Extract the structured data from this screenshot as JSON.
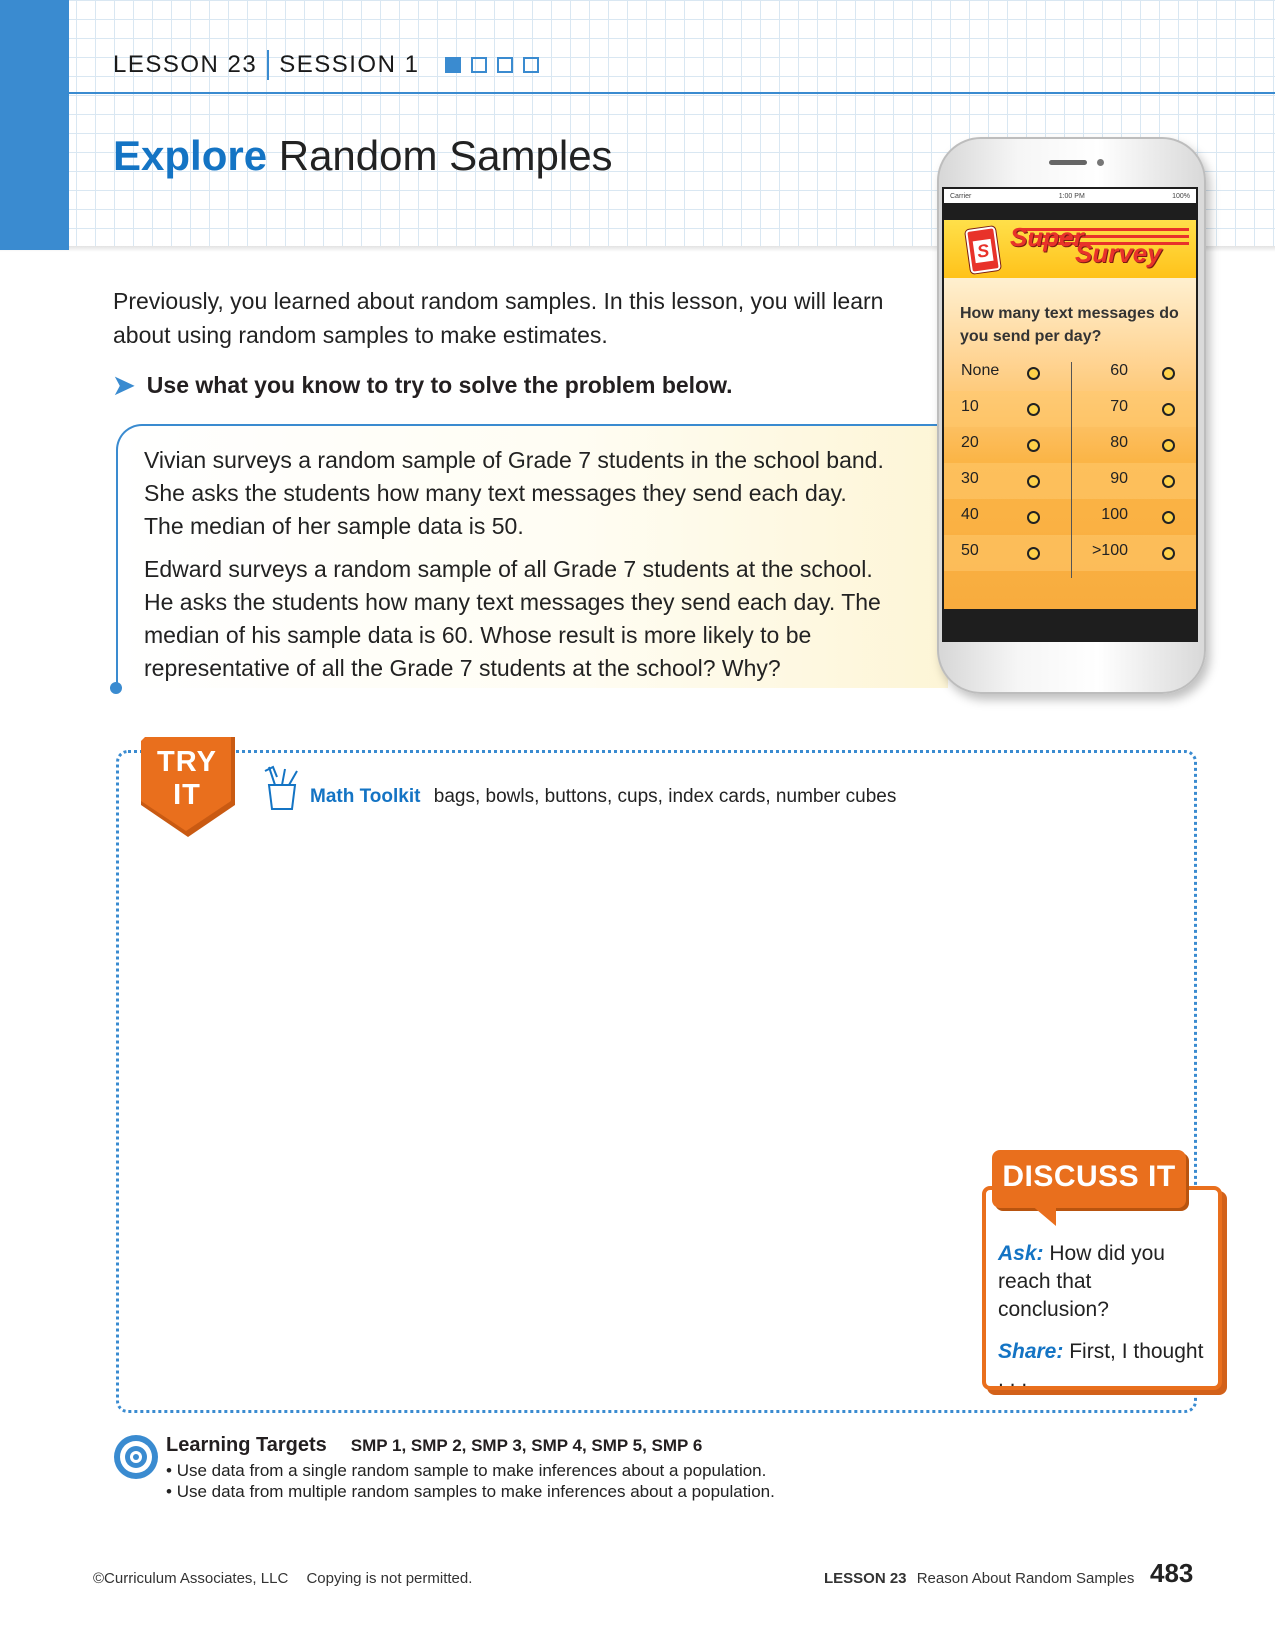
{
  "header": {
    "lesson": "LESSON 23",
    "session": "SESSION 1",
    "session_progress": {
      "current": 1,
      "total": 4
    },
    "title_emphasis": "Explore",
    "title_rest": "Random Samples"
  },
  "intro": "Previously, you learned about random samples. In this lesson, you will learn about using random samples to make estimates.",
  "instruction": "Use what you know to try to solve the problem below.",
  "problem": {
    "p1": "Vivian surveys a random sample of Grade 7 students in the school band. She asks the students how many text messages they send each day. The median of her sample data is 50.",
    "p2": "Edward surveys a random sample of all Grade 7 students at the school. He asks the students how many text messages they send each day. The median of his sample data is 60. Whose result is more likely to be representative of all the Grade 7 students at the school? Why?"
  },
  "phone": {
    "status_carrier": "Carrier",
    "status_time": "1:00 PM",
    "status_battery": "100%",
    "app_word1": "Super",
    "app_word2": "Survey",
    "logo_letter": "S",
    "question": "How many text messages do you send per day?",
    "options_left": [
      "None",
      "10",
      "20",
      "30",
      "40",
      "50"
    ],
    "options_right": [
      "60",
      "70",
      "80",
      "90",
      "100",
      ">100"
    ]
  },
  "try_it": {
    "line1": "TRY",
    "line2": "IT",
    "toolkit_label": "Math Toolkit",
    "toolkit_items": "bags, bowls, buttons, cups, index cards, number cubes"
  },
  "discuss": {
    "title": "DISCUSS IT",
    "ask_label": "Ask:",
    "ask_text": "How did you reach that conclusion?",
    "share_label": "Share:",
    "share_text": "First, I thought . . ."
  },
  "learning_targets": {
    "heading": "Learning Targets",
    "smp": "SMP 1, SMP 2, SMP 3, SMP 4, SMP 5, SMP 6",
    "items": [
      "Use data from a single random sample to make inferences about a population.",
      "Use data from multiple random samples to make inferences about a population."
    ]
  },
  "footer": {
    "copyright": "©Curriculum Associates, LLC",
    "notice": "Copying is not permitted.",
    "lesson": "LESSON 23",
    "lesson_title": "Reason About Random Samples",
    "page": "483"
  },
  "colors": {
    "accent_blue": "#3a8bd0",
    "title_blue": "#1474c4",
    "orange": "#e96f1d",
    "survey_red": "#e8322a"
  }
}
